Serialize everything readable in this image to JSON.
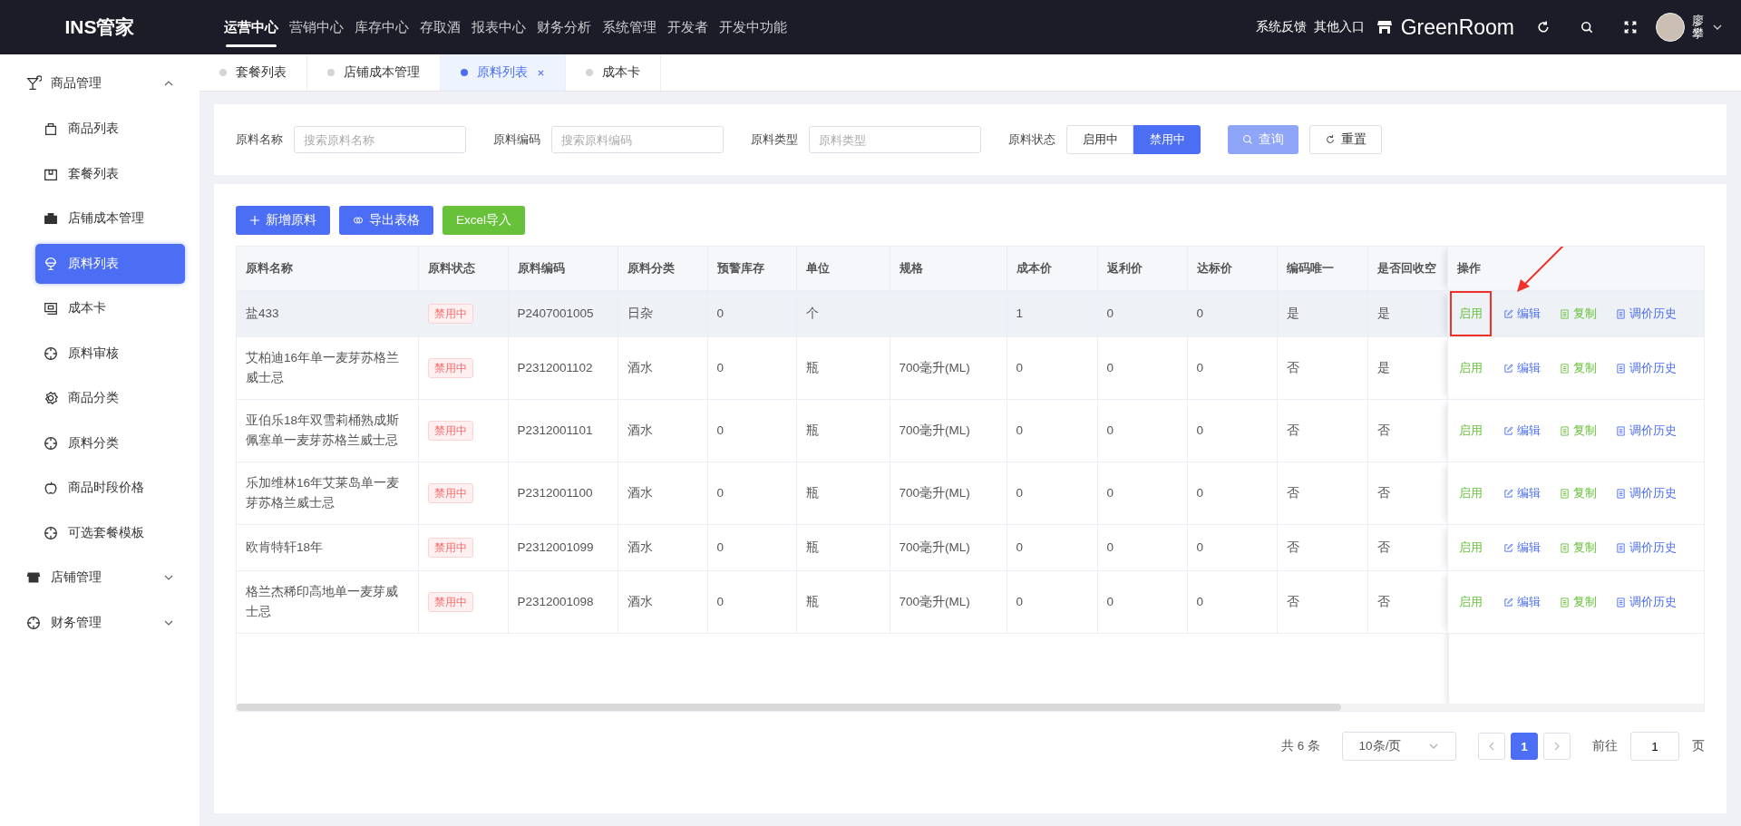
{
  "app": {
    "logo": "INS管家"
  },
  "top_menu": [
    {
      "label": "运营中心",
      "selected": true
    },
    {
      "label": "营销中心",
      "selected": false
    },
    {
      "label": "库存中心",
      "selected": false
    },
    {
      "label": "存取酒",
      "selected": false
    },
    {
      "label": "报表中心",
      "selected": false
    },
    {
      "label": "财务分析",
      "selected": false
    },
    {
      "label": "系统管理",
      "selected": false
    },
    {
      "label": "开发者",
      "selected": false
    },
    {
      "label": "开发中功能",
      "selected": false
    }
  ],
  "header_right": {
    "links": [
      "系统反馈",
      "其他入口"
    ],
    "store": "GreenRoom",
    "user": "廖攀"
  },
  "sidebar": [
    {
      "label": "商品管理",
      "kind": "cocktail",
      "expanded": true,
      "children": [
        {
          "label": "商品列表",
          "kind": "bag",
          "selected": false
        },
        {
          "label": "套餐列表",
          "kind": "box",
          "selected": false
        },
        {
          "label": "店铺成本管理",
          "kind": "briefcase",
          "selected": false
        },
        {
          "label": "原料列表",
          "kind": "icecream",
          "selected": true
        },
        {
          "label": "成本卡",
          "kind": "card",
          "selected": false
        },
        {
          "label": "原料审核",
          "kind": "target",
          "selected": false
        },
        {
          "label": "商品分类",
          "kind": "gear",
          "selected": false
        },
        {
          "label": "原料分类",
          "kind": "target",
          "selected": false
        },
        {
          "label": "商品时段价格",
          "kind": "apple",
          "selected": false
        },
        {
          "label": "可选套餐模板",
          "kind": "target",
          "selected": false
        }
      ]
    },
    {
      "label": "店铺管理",
      "kind": "store",
      "expanded": false
    },
    {
      "label": "财务管理",
      "kind": "target",
      "expanded": false
    }
  ],
  "tabs": [
    {
      "label": "套餐列表",
      "selected": false
    },
    {
      "label": "店铺成本管理",
      "selected": false
    },
    {
      "label": "原料列表",
      "selected": true
    },
    {
      "label": "成本卡",
      "selected": false
    }
  ],
  "filters": [
    {
      "label": "原料名称",
      "placeholder": "搜索原料名称"
    },
    {
      "label": "原料编码",
      "placeholder": "搜索原料编码"
    },
    {
      "label": "原料类型",
      "placeholder": "原料类型"
    }
  ],
  "status_filter": {
    "label": "原料状态",
    "options": [
      {
        "label": "启用中",
        "selected": false
      },
      {
        "label": "禁用中",
        "selected": true
      }
    ]
  },
  "search_button": "查询",
  "reset_button": "重置",
  "toolbar": [
    {
      "label": "新增原料",
      "kind": "add"
    },
    {
      "label": "导出表格",
      "kind": "export"
    },
    {
      "label": "Excel导入",
      "kind": "import"
    }
  ],
  "table": {
    "columns": [
      "原料名称",
      "原料状态",
      "原料编码",
      "原料分类",
      "预警库存",
      "单位",
      "规格",
      "成本价",
      "返利价",
      "达标价",
      "编码唯一",
      "是否回收空",
      "操作"
    ],
    "rows": [
      {
        "selected": true,
        "highlighted": true,
        "cells": [
          "盐433",
          "禁用中",
          "P2407001005",
          "日杂",
          "0",
          "个",
          "",
          "1",
          "0",
          "0",
          "是",
          "是"
        ],
        "actions": [
          {
            "label": "启用",
            "kind": "enable"
          },
          {
            "label": "编辑",
            "kind": "edit"
          },
          {
            "label": "复制",
            "kind": "copy"
          },
          {
            "label": "调价历史",
            "kind": "history"
          }
        ]
      },
      {
        "selected": false,
        "highlighted": false,
        "cells": [
          "艾柏迪16年单一麦芽苏格兰威士忌",
          "禁用中",
          "P2312001102",
          "酒水",
          "0",
          "瓶",
          "700毫升(ML)",
          "0",
          "0",
          "0",
          "否",
          "是"
        ],
        "actions": [
          {
            "label": "启用",
            "kind": "enable"
          },
          {
            "label": "编辑",
            "kind": "edit"
          },
          {
            "label": "复制",
            "kind": "copy"
          },
          {
            "label": "调价历史",
            "kind": "history"
          }
        ]
      },
      {
        "selected": false,
        "highlighted": false,
        "cells": [
          "亚伯乐18年双雪莉桶熟成斯佩塞单一麦芽苏格兰威士忌",
          "禁用中",
          "P2312001101",
          "酒水",
          "0",
          "瓶",
          "700毫升(ML)",
          "0",
          "0",
          "0",
          "否",
          "否"
        ],
        "actions": [
          {
            "label": "启用",
            "kind": "enable"
          },
          {
            "label": "编辑",
            "kind": "edit"
          },
          {
            "label": "复制",
            "kind": "copy"
          },
          {
            "label": "调价历史",
            "kind": "history"
          }
        ]
      },
      {
        "selected": false,
        "highlighted": false,
        "cells": [
          "乐加维林16年艾莱岛单一麦芽苏格兰威士忌",
          "禁用中",
          "P2312001100",
          "酒水",
          "0",
          "瓶",
          "700毫升(ML)",
          "0",
          "0",
          "0",
          "否",
          "否"
        ],
        "actions": [
          {
            "label": "启用",
            "kind": "enable"
          },
          {
            "label": "编辑",
            "kind": "edit"
          },
          {
            "label": "复制",
            "kind": "copy"
          },
          {
            "label": "调价历史",
            "kind": "history"
          }
        ]
      },
      {
        "selected": false,
        "highlighted": false,
        "cells": [
          "欧肯特轩18年",
          "禁用中",
          "P2312001099",
          "酒水",
          "0",
          "瓶",
          "700毫升(ML)",
          "0",
          "0",
          "0",
          "否",
          "否"
        ],
        "actions": [
          {
            "label": "启用",
            "kind": "enable"
          },
          {
            "label": "编辑",
            "kind": "edit"
          },
          {
            "label": "复制",
            "kind": "copy"
          },
          {
            "label": "调价历史",
            "kind": "history"
          }
        ]
      },
      {
        "selected": false,
        "highlighted": false,
        "cells": [
          "格兰杰稀印高地单一麦芽威士忌",
          "禁用中",
          "P2312001098",
          "酒水",
          "0",
          "瓶",
          "700毫升(ML)",
          "0",
          "0",
          "0",
          "否",
          "否"
        ],
        "actions": [
          {
            "label": "启用",
            "kind": "enable"
          },
          {
            "label": "编辑",
            "kind": "edit"
          },
          {
            "label": "复制",
            "kind": "copy"
          },
          {
            "label": "调价历史",
            "kind": "history"
          }
        ]
      }
    ]
  },
  "pagination": {
    "total": "共 6 条",
    "page_size": "10条/页",
    "pages": [
      {
        "label": "1",
        "selected": true
      }
    ],
    "goto_label": "前往",
    "goto_value": "1",
    "goto_suffix": "页"
  }
}
